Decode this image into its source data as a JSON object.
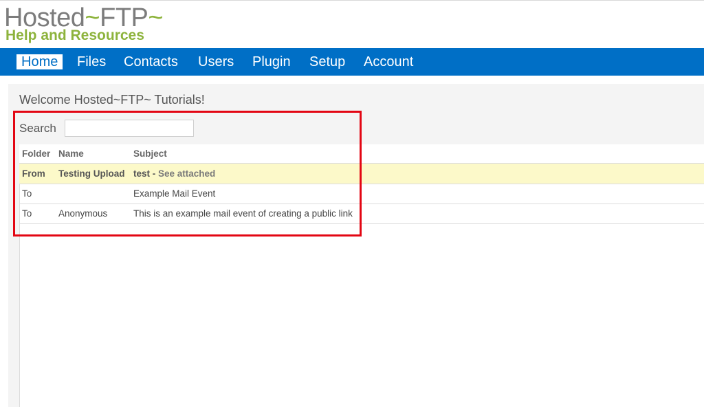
{
  "logo": {
    "brand": "Hosted",
    "tilde1": "~",
    "product": "FTP",
    "tilde2": "~",
    "tagline": "Help and Resources"
  },
  "nav": {
    "items": [
      "Home",
      "Files",
      "Contacts",
      "Users",
      "Plugin",
      "Setup",
      "Account"
    ],
    "active": "Home"
  },
  "page": {
    "welcome": "Welcome Hosted~FTP~ Tutorials!"
  },
  "search": {
    "label": "Search",
    "value": ""
  },
  "table": {
    "columns": [
      "Folder",
      "Name",
      "Subject"
    ],
    "rows": [
      {
        "folder": "From",
        "name": "Testing Upload",
        "subject": "test - ",
        "subject_extra": "See attached",
        "unread": true
      },
      {
        "folder": "To",
        "name": "",
        "subject": "Example Mail Event",
        "subject_extra": "",
        "unread": false
      },
      {
        "folder": "To",
        "name": "Anonymous",
        "subject": "This is an example mail event of creating a public link",
        "subject_extra": "",
        "unread": false
      }
    ]
  },
  "colors": {
    "nav_bg": "#006fc6",
    "logo_green": "#8db33c",
    "unread_row": "#fcf9c9",
    "highlight_box": "#e30613"
  }
}
